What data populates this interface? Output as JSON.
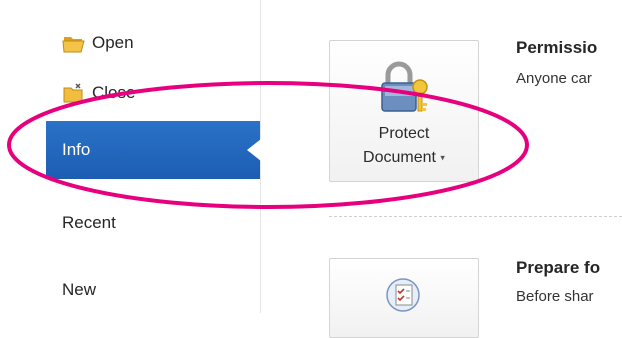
{
  "sidebar": {
    "items": [
      {
        "label": "Open",
        "icon": "folder-open-icon"
      },
      {
        "label": "Close",
        "icon": "folder-close-icon"
      },
      {
        "label": "Info",
        "selected": true
      },
      {
        "label": "Recent"
      },
      {
        "label": "New"
      }
    ]
  },
  "main": {
    "protect": {
      "button_line1": "Protect",
      "button_line2": "Document",
      "caret": "▾",
      "title": "Permissio",
      "description": "Anyone car"
    },
    "prepare": {
      "title": "Prepare fo",
      "description": "Before shar"
    }
  },
  "colors": {
    "selected_bg": "#1c5db3",
    "highlight_ellipse": "#e6007e"
  }
}
